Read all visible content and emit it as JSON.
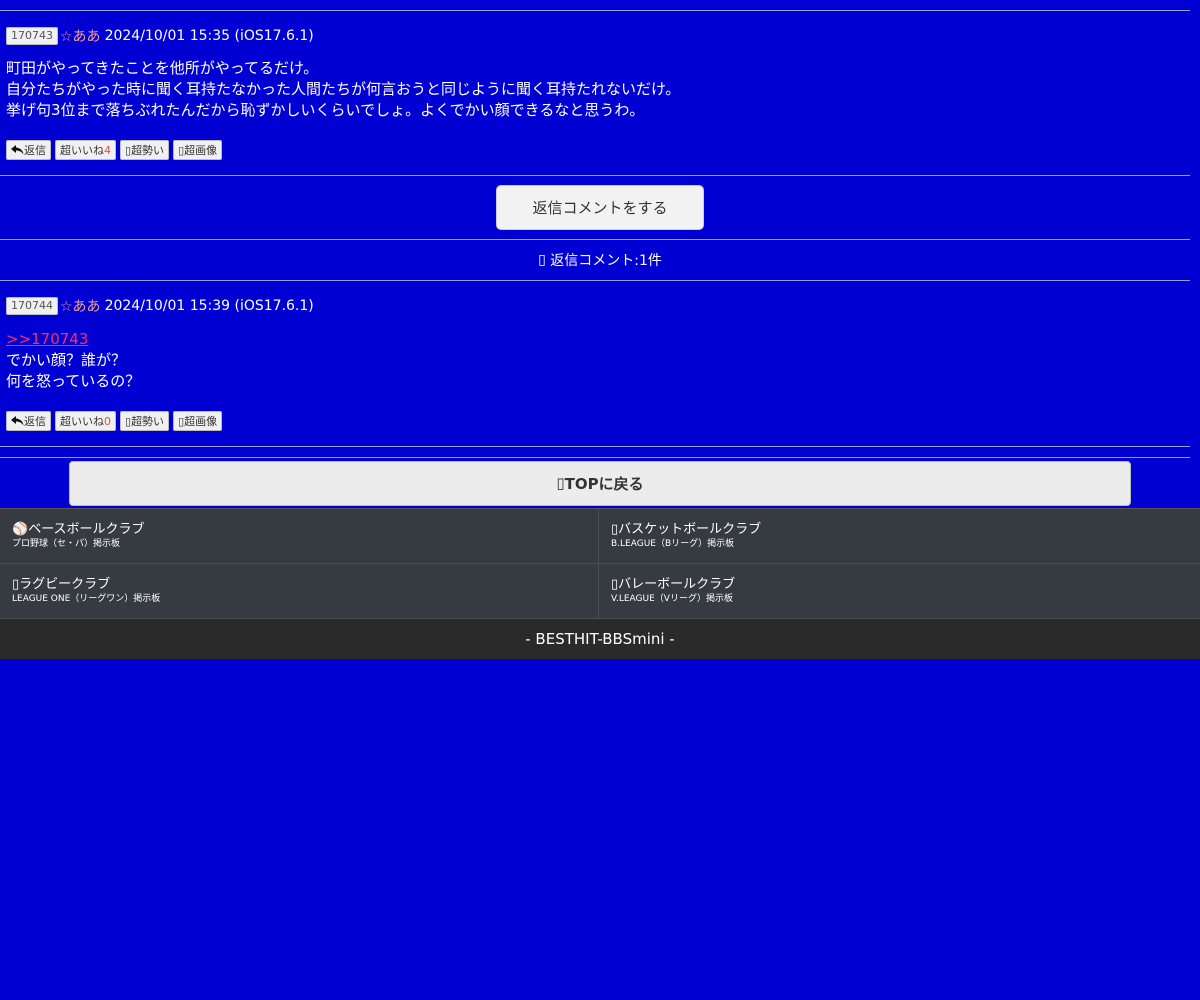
{
  "posts": [
    {
      "id": "170743",
      "author": "☆ああ",
      "date": "2024/10/01 15:35 (iOS17.6.1)",
      "lines": [
        "町田がやってきたことを他所がやってるだけ。",
        "自分たちがやった時に聞く耳持たなかった人間たちが何言おうと同じように聞く耳持たれないだけ。",
        "挙げ句3位まで落ちぶれたんだから恥ずかしいくらいでしょ。よくでかい顔できるなと思うわ。"
      ],
      "actions": {
        "reply": "返信",
        "like": "超いいね",
        "like_count": "4",
        "momentum": "超勢い",
        "image": "超画像"
      }
    },
    {
      "id": "170744",
      "author": "☆ああ",
      "date": "2024/10/01 15:39 (iOS17.6.1)",
      "anchor": ">>170743",
      "lines": [
        "でかい顔？誰が？",
        "何を怒っているの？"
      ],
      "actions": {
        "reply": "返信",
        "like": "超いいね",
        "like_count": "0",
        "momentum": "超勢い",
        "image": "超画像"
      }
    }
  ],
  "reply_button": "返信コメントをする",
  "reply_count": "返信コメント:1件",
  "top_button": "TOPに戻る",
  "clubs": [
    {
      "title": "ベースボールクラブ",
      "sub": "プロ野球（セ・パ）掲示板"
    },
    {
      "title": "バスケットボールクラブ",
      "sub": "B.LEAGUE（Bリーグ）掲示板"
    },
    {
      "title": "ラグビークラブ",
      "sub": "LEAGUE ONE（リーグワン）掲示板"
    },
    {
      "title": "バレーボールクラブ",
      "sub": "V.LEAGUE（Vリーグ）掲示板"
    }
  ],
  "footer": "- BESTHIT-BBSmini -"
}
